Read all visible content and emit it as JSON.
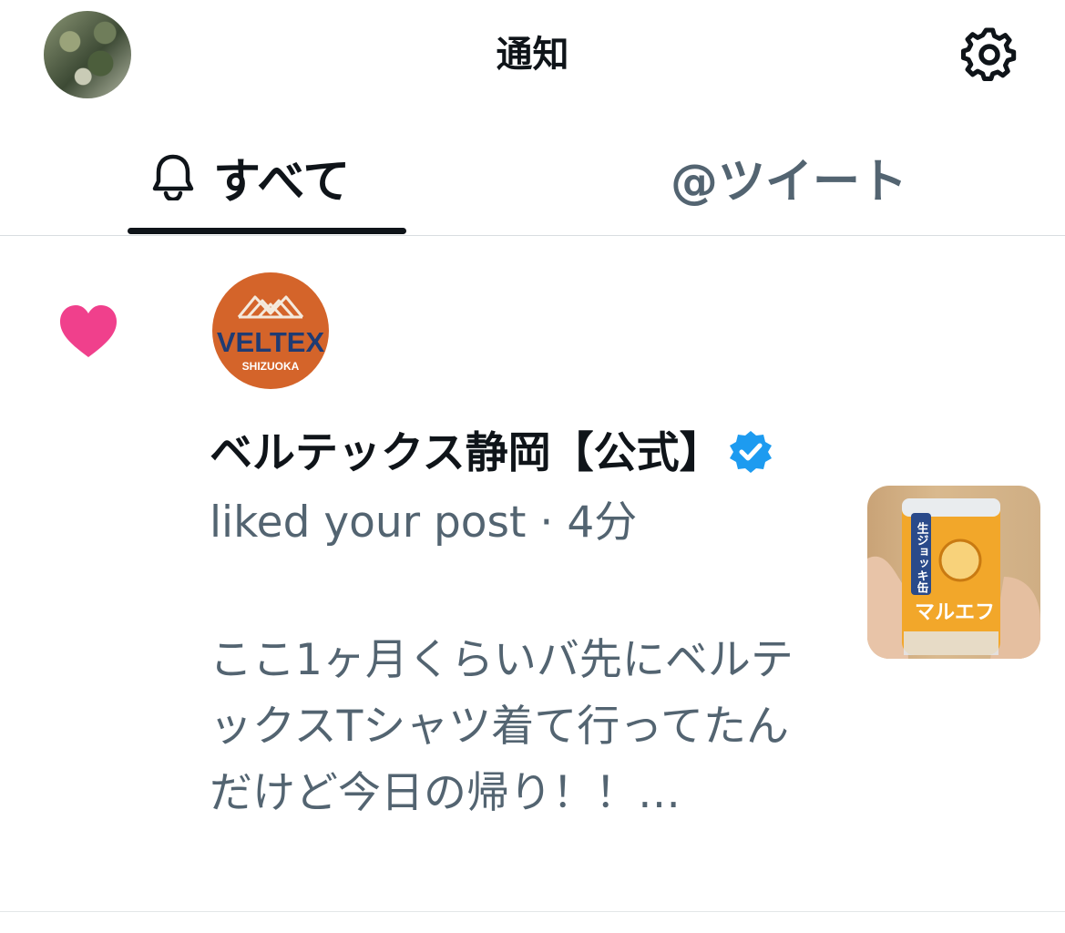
{
  "header": {
    "title": "通知",
    "avatar_icon": "user-avatar",
    "settings_icon": "gear-icon"
  },
  "tabs": [
    {
      "label": "すべて",
      "icon": "bell-icon",
      "active": true
    },
    {
      "label": "@ツイート",
      "active": false
    }
  ],
  "notification": {
    "type_icon": "heart-icon",
    "type_color": "#f0408c",
    "account_logo_text": "VELTEX",
    "account_logo_subtext": "SHIZUOKA",
    "account_name": "ベルテックス静岡【公式】",
    "verified_icon": "verified-badge-icon",
    "action": " liked your post",
    "separator": " · ",
    "time": "4分",
    "post_text": "ここ1ヶ月くらいバ先にベルテックスTシャツ着て行ってたんだけど今日の帰り！！…",
    "thumbnail": {
      "can_label": "マルエフ",
      "can_tag": "生ジョッキ缶"
    }
  },
  "colors": {
    "accent_text": "#0f1419",
    "secondary_text": "#536471",
    "verified_blue": "#1d9bf0",
    "logo_orange": "#d4642a"
  }
}
